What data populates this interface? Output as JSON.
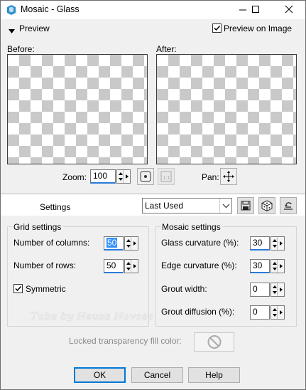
{
  "window": {
    "title": "Mosaic - Glass"
  },
  "preview": {
    "toggle_label": "Preview",
    "preview_on_image_label": "Preview on Image",
    "preview_on_image_checked": true,
    "before_label": "Before:",
    "after_label": "After:",
    "zoom_label": "Zoom:",
    "zoom_value": "100",
    "pan_label": "Pan:"
  },
  "settings": {
    "label": "Settings",
    "preset_value": "Last Used"
  },
  "grid": {
    "title": "Grid settings",
    "columns_label": "Number of columns:",
    "columns_value": "50",
    "rows_label": "Number of rows:",
    "rows_value": "50",
    "symmetric_label": "Symmetric",
    "symmetric_checked": true
  },
  "mosaic": {
    "title": "Mosaic settings",
    "glass_label": "Glass curvature (%):",
    "glass_value": "30",
    "edge_label": "Edge curvature (%):",
    "edge_value": "30",
    "grout_width_label": "Grout width:",
    "grout_width_value": "0",
    "grout_diffusion_label": "Grout diffusion (%):",
    "grout_diffusion_value": "0"
  },
  "locked": {
    "label": "Locked transparency fill color:"
  },
  "buttons": {
    "ok": "OK",
    "cancel": "Cancel",
    "help": "Help"
  },
  "watermark": "Tube by Neusa Novaes",
  "colors": {
    "accent": "#2b7bd6",
    "default_button_border": "#0078d7"
  }
}
